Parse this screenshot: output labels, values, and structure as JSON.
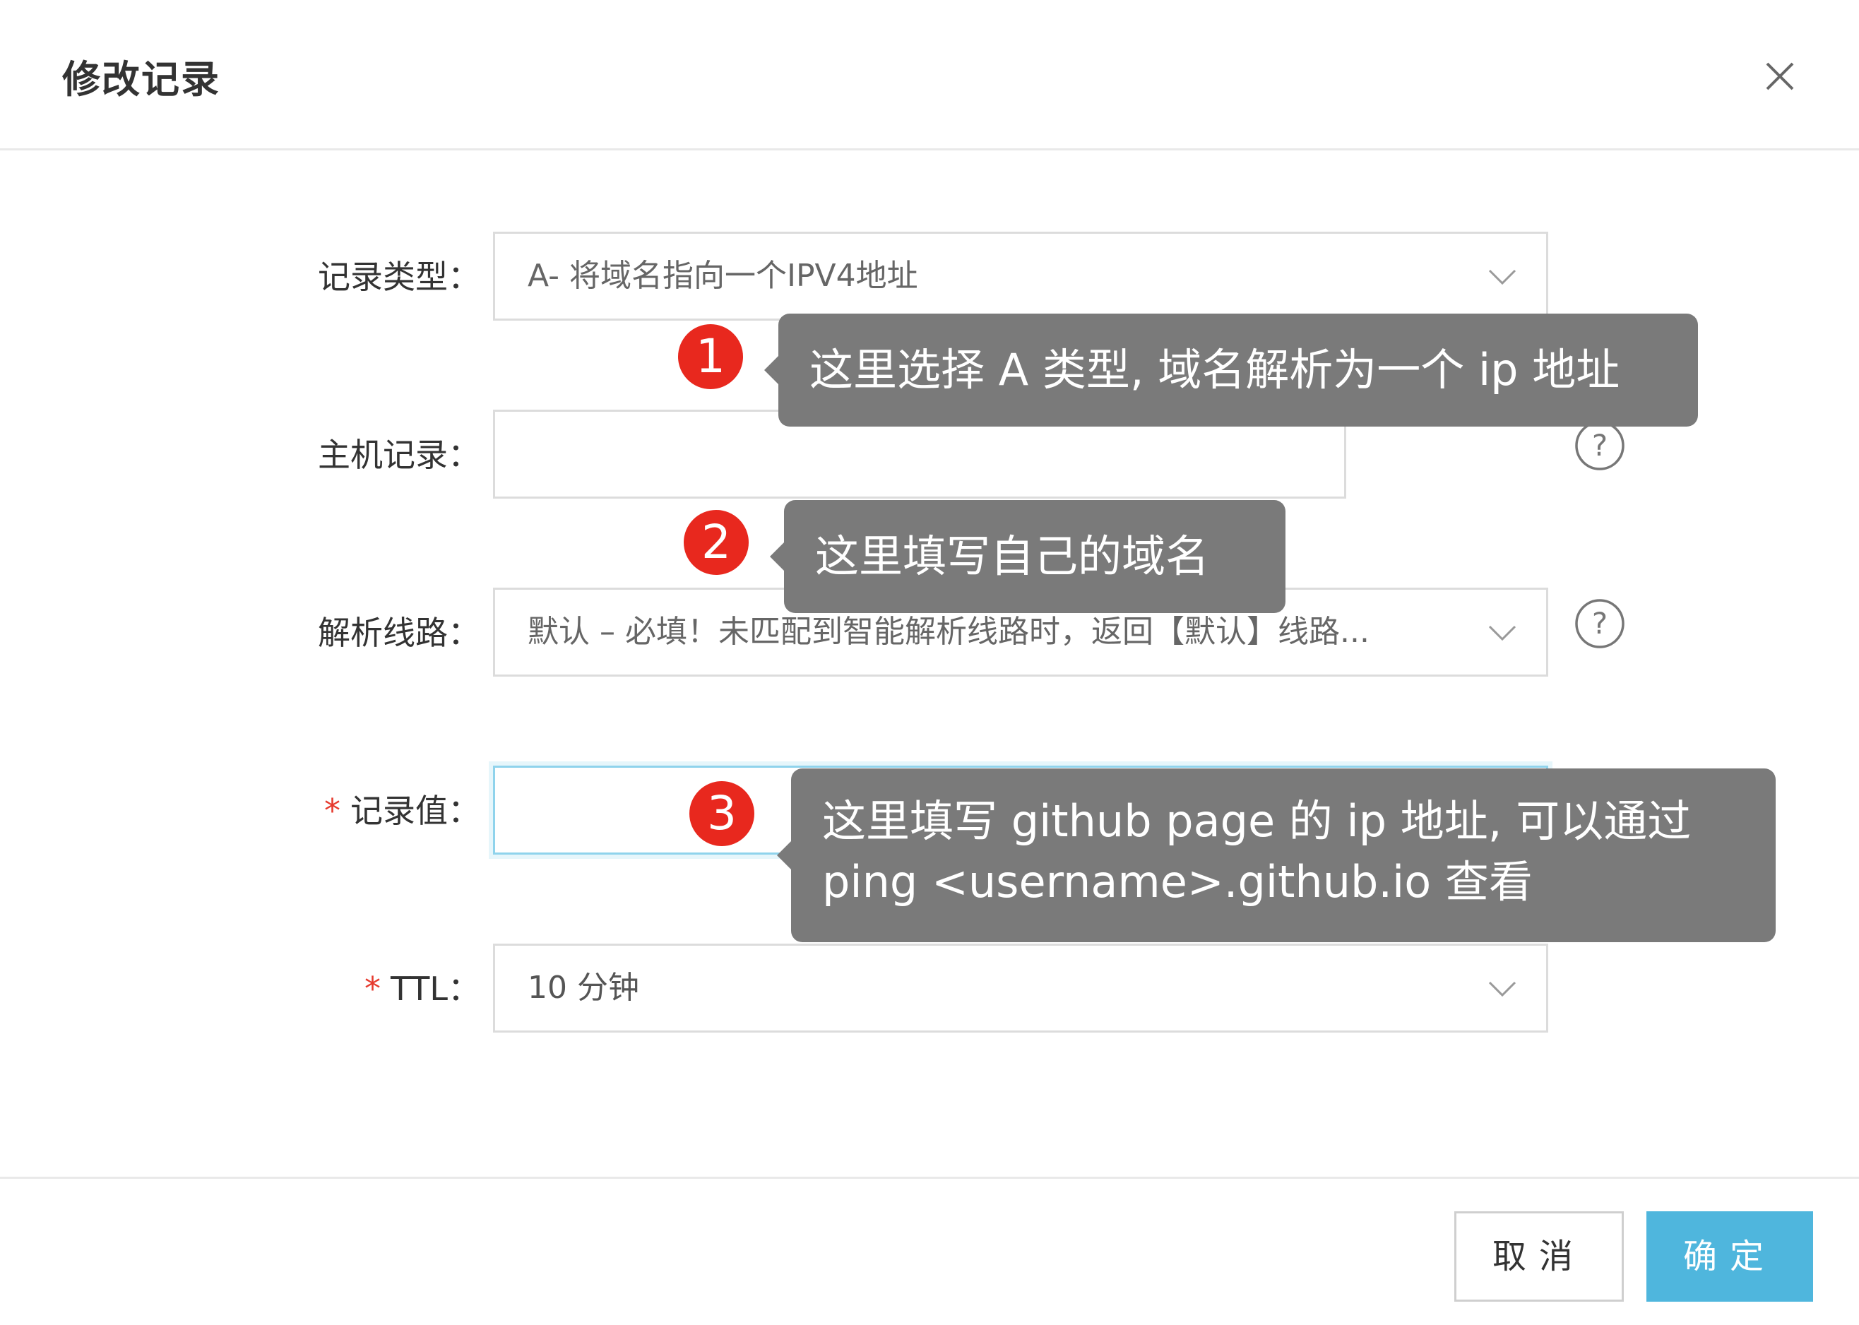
{
  "dialog": {
    "title": "修改记录",
    "close_icon": "close-icon"
  },
  "form": {
    "record_type": {
      "label": "记录类型：",
      "value": "A- 将域名指向一个IPV4地址"
    },
    "host_record": {
      "label": "主机记录：",
      "value": ""
    },
    "line": {
      "label": "解析线路：",
      "value": "默认 – 必填！未匹配到智能解析线路时，返回【默认】线路..."
    },
    "record_value": {
      "required_mark": "*",
      "label": "记录值：",
      "value": ""
    },
    "ttl": {
      "required_mark": "*",
      "label": "TTL：",
      "value": "10 分钟"
    }
  },
  "annotations": [
    {
      "number": "1",
      "lines": [
        "这里选择 A 类型, 域名解析为一个 ip 地址"
      ]
    },
    {
      "number": "2",
      "lines": [
        "这里填写自己的域名"
      ]
    },
    {
      "number": "3",
      "lines": [
        "这里填写 github page 的 ip 地址, 可以通过",
        "ping <username>.github.io 查看"
      ]
    }
  ],
  "footer": {
    "cancel_label": "取消",
    "ok_label": "确定"
  },
  "colors": {
    "primary": "#4fb6dd",
    "required": "#e63a2e",
    "badge": "#e8281e",
    "callout": "#7a7a7a"
  }
}
